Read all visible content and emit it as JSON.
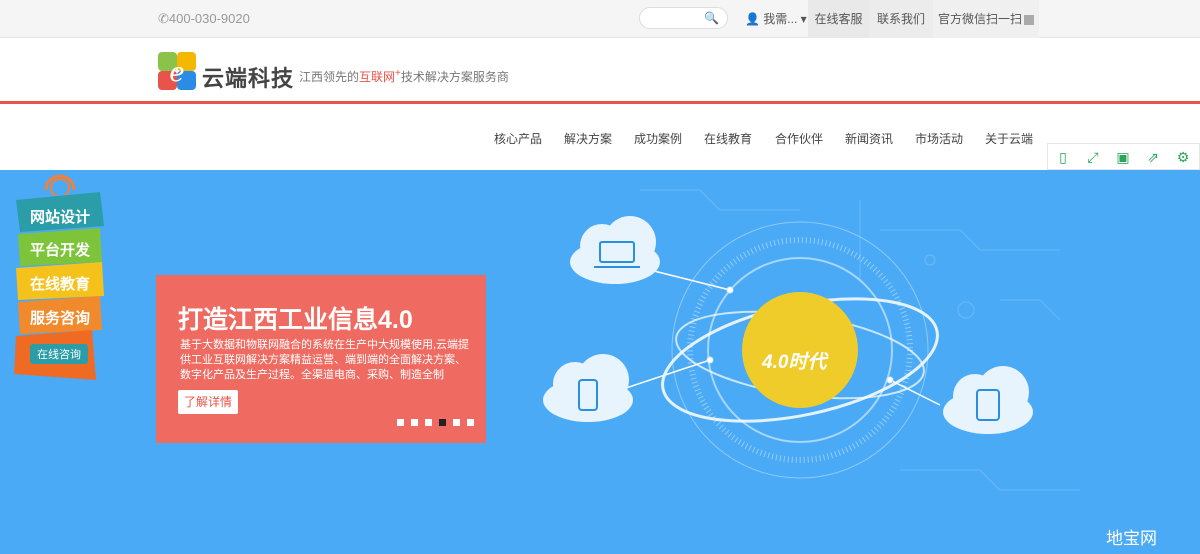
{
  "topbar": {
    "phone": "✆400-030-9020",
    "search_placeholder": "",
    "search_icon": "search-icon",
    "need_label": "我需...",
    "service_label": "在线客服",
    "contact_label": "联系我们",
    "wechat_label": "官方微信扫一扫"
  },
  "brand": {
    "name": "云端科技",
    "slogan_pre": "江西领先的",
    "slogan_hl": "互联网",
    "slogan_plus": "+",
    "slogan_post": "技术解决方案服务商",
    "accent": "#e8534a"
  },
  "nav": {
    "items": [
      "核心产品",
      "解决方案",
      "成功案例",
      "在线教育",
      "合作伙伴",
      "新闻资讯",
      "市场活动",
      "关于云端"
    ]
  },
  "hero": {
    "bg": "#4aaaf5",
    "promo_title": "打造江西工业信息4.0",
    "promo_desc": "基于大数据和物联网融合的系统在生产中大规模使用,云端提供工业互联网解决方案精益运营、端到端的全面解决方案、数字化产品及生产过程。全渠道电商、采购、制造全制",
    "promo_button": "了解详情",
    "badge": "4.0时代",
    "slides_total": 6,
    "slide_active": 4
  },
  "side_menu": {
    "items": [
      "网站设计",
      "平台开发",
      "在线教育",
      "服务咨询"
    ],
    "consult": "在线咨询"
  },
  "watermark": "地宝网"
}
